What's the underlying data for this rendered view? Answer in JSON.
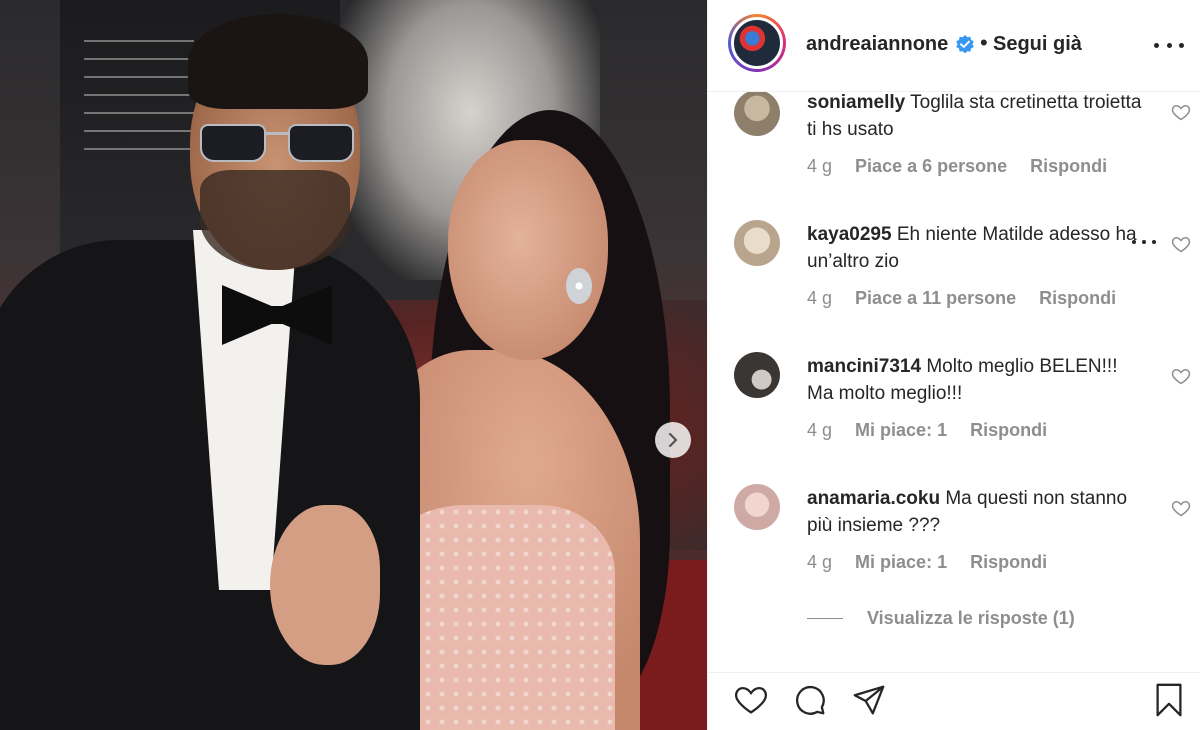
{
  "header": {
    "username": "andreaiannone",
    "separator": "•",
    "follow_label": "Segui già"
  },
  "comments": [
    {
      "username": "soniamelly",
      "text": "Toglila sta cretinetta troietta ti hs usato",
      "age": "4 g",
      "likes": "Piace a 6 persone",
      "reply_label": "Rispondi",
      "avatar_color": "#8d7f6a"
    },
    {
      "username": "kaya0295",
      "text": "Eh niente Matilde adesso ha un’altro zio",
      "age": "4 g",
      "likes": "Piace a 11 persone",
      "reply_label": "Rispondi",
      "avatar_color": "#d9cbb8"
    },
    {
      "username": "mancini7314",
      "text": "Molto meglio BELEN!!! Ma molto meglio!!!",
      "age": "4 g",
      "likes": "Mi piace: 1",
      "reply_label": "Rispondi",
      "avatar_color": "#3a3633"
    },
    {
      "username": "anamaria.coku",
      "text": "Ma questi non stanno più insieme ???",
      "age": "4 g",
      "likes": "Mi piace: 1",
      "reply_label": "Rispondi",
      "avatar_color": "#cfa9a3"
    }
  ],
  "view_replies": "Visualizza le risposte (1)",
  "colors": {
    "text": "#262626",
    "muted": "#8e8e8e",
    "verified": "#3897f0",
    "border": "#efefef"
  },
  "icons": [
    "chevron-right-icon",
    "verified-badge-icon",
    "more-options-icon",
    "heart-icon",
    "comment-icon",
    "share-icon",
    "bookmark-icon"
  ]
}
